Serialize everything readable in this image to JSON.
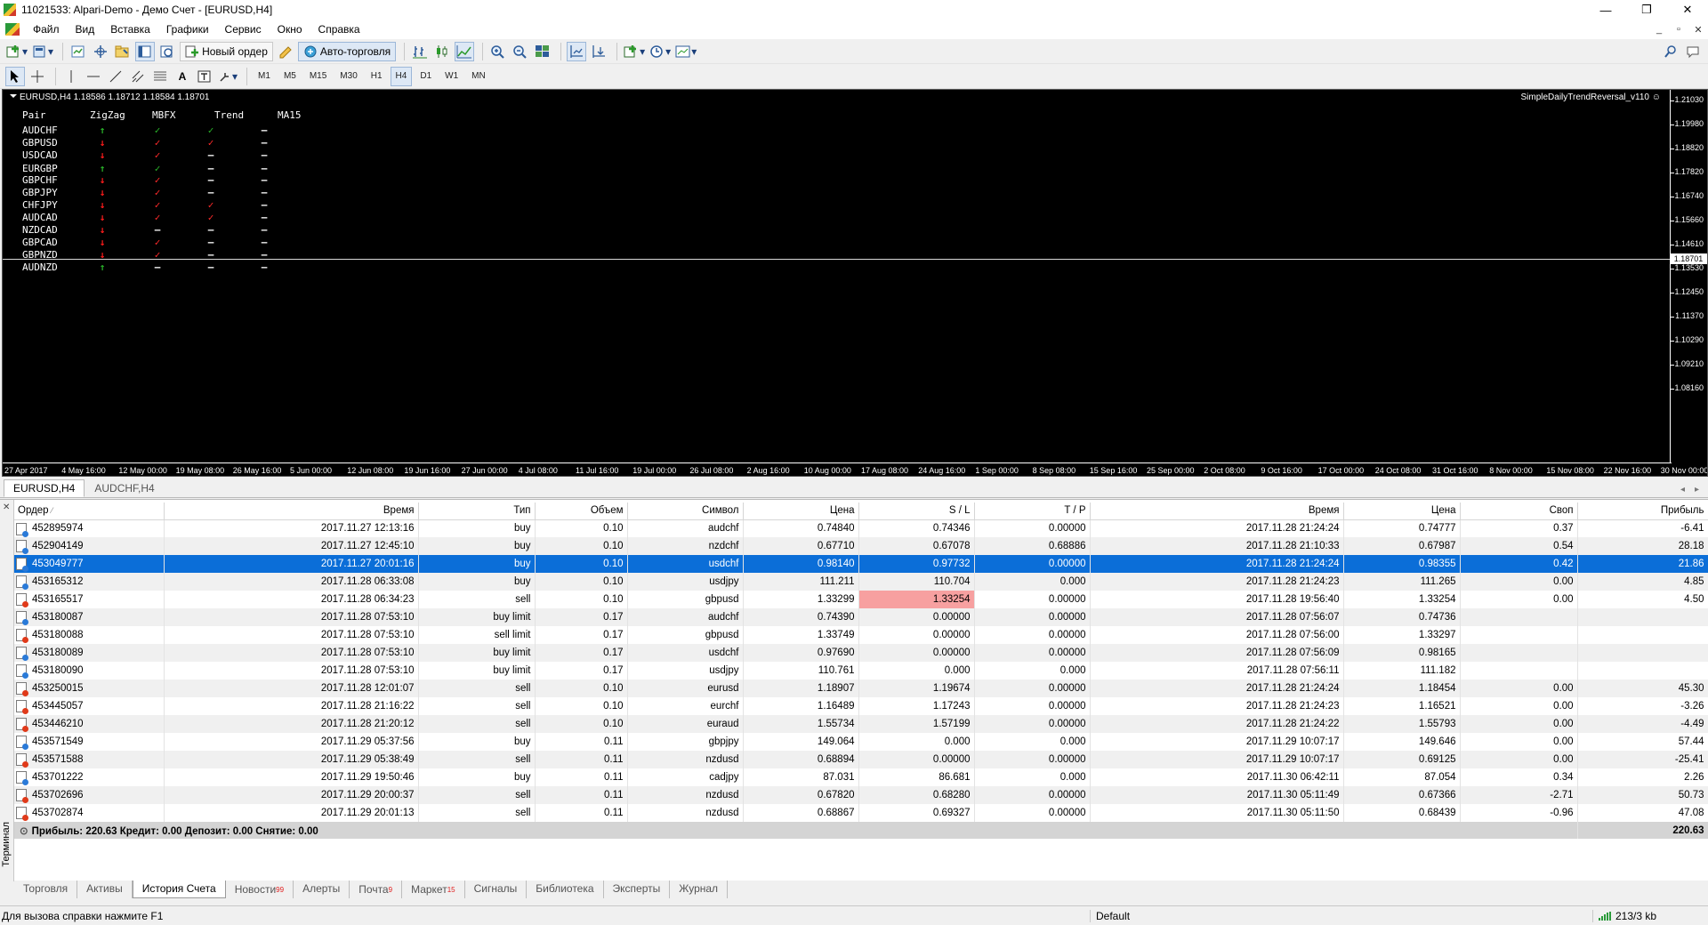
{
  "window": {
    "title": "11021533: Alpari-Demo - Демо Счет - [EURUSD,H4]",
    "controls": [
      "—",
      "❐",
      "✕"
    ],
    "mdi_controls": [
      "_",
      "▫",
      "✕"
    ]
  },
  "menu": [
    "Файл",
    "Вид",
    "Вставка",
    "Графики",
    "Сервис",
    "Окно",
    "Справка"
  ],
  "toolbar": {
    "new_order": "Новый ордер",
    "auto_trading": "Авто-торговля"
  },
  "timeframes": [
    "M1",
    "M5",
    "M15",
    "M30",
    "H1",
    "H4",
    "D1",
    "W1",
    "MN"
  ],
  "active_timeframe": "H4",
  "chart": {
    "header": "EURUSD,H4  1.18586 1.18712 1.18584 1.18701",
    "indicator": "SimpleDailyTrendReversal_v110",
    "current_price": "1.18701",
    "y_ticks": [
      "1.21030",
      "1.19980",
      "1.18820",
      "1.17820",
      "1.16740",
      "1.15660",
      "1.14610",
      "1.13530",
      "1.12450",
      "1.11370",
      "1.10290",
      "1.09210",
      "1.08160"
    ],
    "x_ticks": [
      "27 Apr 2017",
      "4 May 16:00",
      "12 May 00:00",
      "19 May 08:00",
      "26 May 16:00",
      "5 Jun 00:00",
      "12 Jun 08:00",
      "19 Jun 16:00",
      "27 Jun 00:00",
      "4 Jul 08:00",
      "11 Jul 16:00",
      "19 Jul 00:00",
      "26 Jul 08:00",
      "2 Aug 16:00",
      "10 Aug 00:00",
      "17 Aug 08:00",
      "24 Aug 16:00",
      "1 Sep 00:00",
      "8 Sep 08:00",
      "15 Sep 16:00",
      "25 Sep 00:00",
      "2 Oct 08:00",
      "9 Oct 16:00",
      "17 Oct 00:00",
      "24 Oct 08:00",
      "31 Oct 16:00",
      "8 Nov 00:00",
      "15 Nov 08:00",
      "22 Nov 16:00",
      "30 Nov 00:00"
    ]
  },
  "pairs_table": {
    "headers": [
      "Pair",
      "ZigZag",
      "MBFX",
      "Trend",
      "MA15"
    ],
    "rows": [
      {
        "pair": "AUDCHF",
        "zigzag": "up",
        "mbfx": "green",
        "trend": "green",
        "ma15": "dash"
      },
      {
        "pair": "GBPUSD",
        "zigzag": "down",
        "mbfx": "red",
        "trend": "red",
        "ma15": "dash"
      },
      {
        "pair": "USDCAD",
        "zigzag": "down",
        "mbfx": "red",
        "trend": "dash",
        "ma15": "dash"
      },
      {
        "pair": "EURGBP",
        "zigzag": "up",
        "mbfx": "green",
        "trend": "dash",
        "ma15": "dash"
      },
      {
        "pair": "GBPCHF",
        "zigzag": "down",
        "mbfx": "red",
        "trend": "dash",
        "ma15": "dash"
      },
      {
        "pair": "GBPJPY",
        "zigzag": "down",
        "mbfx": "red",
        "trend": "dash",
        "ma15": "dash"
      },
      {
        "pair": "CHFJPY",
        "zigzag": "down",
        "mbfx": "red",
        "trend": "red",
        "ma15": "dash"
      },
      {
        "pair": "AUDCAD",
        "zigzag": "down",
        "mbfx": "red",
        "trend": "red",
        "ma15": "dash"
      },
      {
        "pair": "NZDCAD",
        "zigzag": "down",
        "mbfx": "dash",
        "trend": "dash",
        "ma15": "dash"
      },
      {
        "pair": "GBPCAD",
        "zigzag": "down",
        "mbfx": "red",
        "trend": "dash",
        "ma15": "dash"
      },
      {
        "pair": "GBPNZD",
        "zigzag": "down",
        "mbfx": "red",
        "trend": "dash",
        "ma15": "dash"
      },
      {
        "pair": "AUDNZD",
        "zigzag": "up",
        "mbfx": "dash",
        "trend": "dash",
        "ma15": "dash"
      }
    ]
  },
  "chart_tabs": [
    "EURUSD,H4",
    "AUDCHF,H4"
  ],
  "terminal": {
    "side_label": "Терминал",
    "columns": [
      "Ордер",
      "Время",
      "Тип",
      "Объем",
      "Символ",
      "Цена",
      "S / L",
      "T / P",
      "Время",
      "Цена",
      "Своп",
      "Прибыль"
    ],
    "rows": [
      [
        "452895974",
        "2017.11.27 12:13:16",
        "buy",
        "0.10",
        "audchf",
        "0.74840",
        "0.74346",
        "0.00000",
        "2017.11.28 21:24:24",
        "0.74777",
        "0.37",
        "-6.41"
      ],
      [
        "452904149",
        "2017.11.27 12:45:10",
        "buy",
        "0.10",
        "nzdchf",
        "0.67710",
        "0.67078",
        "0.68886",
        "2017.11.28 21:10:33",
        "0.67987",
        "0.54",
        "28.18"
      ],
      [
        "453049777",
        "2017.11.27 20:01:16",
        "buy",
        "0.10",
        "usdchf",
        "0.98140",
        "0.97732",
        "0.00000",
        "2017.11.28 21:24:24",
        "0.98355",
        "0.42",
        "21.86"
      ],
      [
        "453165312",
        "2017.11.28 06:33:08",
        "buy",
        "0.10",
        "usdjpy",
        "111.211",
        "110.704",
        "0.000",
        "2017.11.28 21:24:23",
        "111.265",
        "0.00",
        "4.85"
      ],
      [
        "453165517",
        "2017.11.28 06:34:23",
        "sell",
        "0.10",
        "gbpusd",
        "1.33299",
        "1.33254",
        "0.00000",
        "2017.11.28 19:56:40",
        "1.33254",
        "0.00",
        "4.50"
      ],
      [
        "453180087",
        "2017.11.28 07:53:10",
        "buy limit",
        "0.17",
        "audchf",
        "0.74390",
        "0.00000",
        "0.00000",
        "2017.11.28 07:56:07",
        "0.74736",
        "",
        ""
      ],
      [
        "453180088",
        "2017.11.28 07:53:10",
        "sell limit",
        "0.17",
        "gbpusd",
        "1.33749",
        "0.00000",
        "0.00000",
        "2017.11.28 07:56:00",
        "1.33297",
        "",
        ""
      ],
      [
        "453180089",
        "2017.11.28 07:53:10",
        "buy limit",
        "0.17",
        "usdchf",
        "0.97690",
        "0.00000",
        "0.00000",
        "2017.11.28 07:56:09",
        "0.98165",
        "",
        ""
      ],
      [
        "453180090",
        "2017.11.28 07:53:10",
        "buy limit",
        "0.17",
        "usdjpy",
        "110.761",
        "0.000",
        "0.000",
        "2017.11.28 07:56:11",
        "111.182",
        "",
        ""
      ],
      [
        "453250015",
        "2017.11.28 12:01:07",
        "sell",
        "0.10",
        "eurusd",
        "1.18907",
        "1.19674",
        "0.00000",
        "2017.11.28 21:24:24",
        "1.18454",
        "0.00",
        "45.30"
      ],
      [
        "453445057",
        "2017.11.28 21:16:22",
        "sell",
        "0.10",
        "eurchf",
        "1.16489",
        "1.17243",
        "0.00000",
        "2017.11.28 21:24:23",
        "1.16521",
        "0.00",
        "-3.26"
      ],
      [
        "453446210",
        "2017.11.28 21:20:12",
        "sell",
        "0.10",
        "euraud",
        "1.55734",
        "1.57199",
        "0.00000",
        "2017.11.28 21:24:22",
        "1.55793",
        "0.00",
        "-4.49"
      ],
      [
        "453571549",
        "2017.11.29 05:37:56",
        "buy",
        "0.11",
        "gbpjpy",
        "149.064",
        "0.000",
        "0.000",
        "2017.11.29 10:07:17",
        "149.646",
        "0.00",
        "57.44"
      ],
      [
        "453571588",
        "2017.11.29 05:38:49",
        "sell",
        "0.11",
        "nzdusd",
        "0.68894",
        "0.00000",
        "0.00000",
        "2017.11.29 10:07:17",
        "0.69125",
        "0.00",
        "-25.41"
      ],
      [
        "453701222",
        "2017.11.29 19:50:46",
        "buy",
        "0.11",
        "cadjpy",
        "87.031",
        "86.681",
        "0.000",
        "2017.11.30 06:42:11",
        "87.054",
        "0.34",
        "2.26"
      ],
      [
        "453702696",
        "2017.11.29 20:00:37",
        "sell",
        "0.11",
        "nzdusd",
        "0.67820",
        "0.68280",
        "0.00000",
        "2017.11.30 05:11:49",
        "0.67366",
        "-2.71",
        "50.73"
      ],
      [
        "453702874",
        "2017.11.29 20:01:13",
        "sell",
        "0.11",
        "nzdusd",
        "0.68867",
        "0.69327",
        "0.00000",
        "2017.11.30 05:11:50",
        "0.68439",
        "-0.96",
        "47.08"
      ]
    ],
    "selected_row": 2,
    "highlighted_sl_row": 4,
    "total_label": "Прибыль: 220.63  Кредит: 0.00  Депозит: 0.00  Снятие: 0.00",
    "total_value": "220.63",
    "tabs": [
      {
        "label": "Торговля",
        "badge": ""
      },
      {
        "label": "Активы",
        "badge": ""
      },
      {
        "label": "История Счета",
        "badge": ""
      },
      {
        "label": "Новости",
        "badge": "99"
      },
      {
        "label": "Алерты",
        "badge": ""
      },
      {
        "label": "Почта",
        "badge": "9"
      },
      {
        "label": "Маркет",
        "badge": "15"
      },
      {
        "label": "Сигналы",
        "badge": ""
      },
      {
        "label": "Библиотека",
        "badge": ""
      },
      {
        "label": "Эксперты",
        "badge": ""
      },
      {
        "label": "Журнал",
        "badge": ""
      }
    ],
    "active_tab": 2
  },
  "status": {
    "help": "Для вызова справки нажмите F1",
    "profile": "Default",
    "traffic": "213/3 kb"
  },
  "colors": {
    "chart_bg": "#000000",
    "selected_row": "#0b6ed8",
    "sl_highlight": "#f7a0a0",
    "up_arrow": "#2ab52a",
    "down_arrow": "#ff1c1c"
  }
}
